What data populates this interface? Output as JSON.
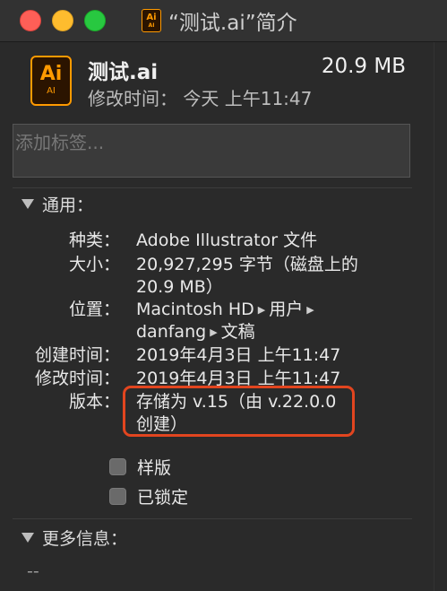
{
  "window": {
    "title": "“测试.ai”简介",
    "icon_text": "Ai",
    "icon_sub": "AI"
  },
  "file": {
    "name": "测试.ai",
    "size": "20.9 MB",
    "modified_label": "修改时间：",
    "modified_value": "今天 上午11:47",
    "icon_text": "Ai",
    "icon_sub": "AI"
  },
  "tags": {
    "placeholder": "添加标签..."
  },
  "general": {
    "heading": "通用：",
    "kind_label": "种类：",
    "kind_value": "Adobe Illustrator 文件",
    "size_label": "大小：",
    "size_value_line1": "20,927,295 字节（磁盘上的",
    "size_value_line2": "20.9 MB）",
    "where_label": "位置：",
    "where_path": [
      "Macintosh HD",
      "用户",
      "danfang",
      "文稿"
    ],
    "created_label": "创建时间：",
    "created_value": "2019年4月3日 上午11:47",
    "modified_label": "修改时间：",
    "modified_value": "2019年4月3日 上午11:47",
    "version_label": "版本：",
    "version_value_line1": "存储为 v.15（由 v.22.0.0",
    "version_value_line2": "创建）",
    "stationery_label": "样版",
    "locked_label": "已锁定"
  },
  "more_info": {
    "heading": "更多信息：",
    "value": "--"
  },
  "colors": {
    "highlight": "#e2451f",
    "ai_orange": "#ff9a00"
  }
}
